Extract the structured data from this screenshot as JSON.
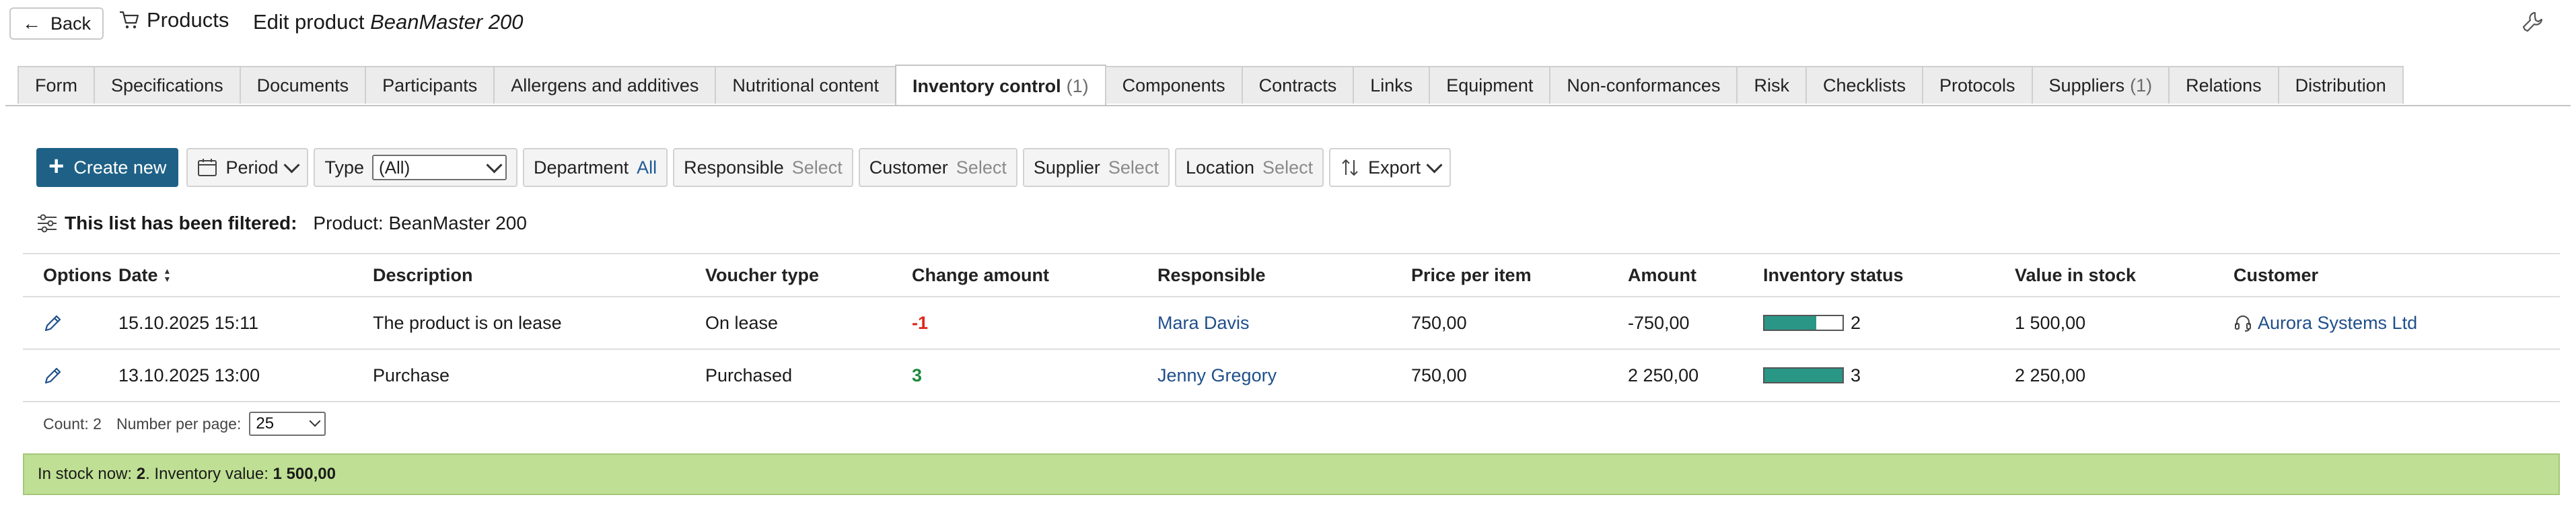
{
  "header": {
    "back_label": "Back",
    "breadcrumb_label": "Products",
    "title_prefix": "Edit product",
    "title_product": "BeanMaster 200"
  },
  "tabs": [
    {
      "label": "Form",
      "count": ""
    },
    {
      "label": "Specifications",
      "count": ""
    },
    {
      "label": "Documents",
      "count": ""
    },
    {
      "label": "Participants",
      "count": ""
    },
    {
      "label": "Allergens and additives",
      "count": ""
    },
    {
      "label": "Nutritional content",
      "count": ""
    },
    {
      "label": "Inventory control",
      "count": "(1)",
      "active": true
    },
    {
      "label": "Components",
      "count": ""
    },
    {
      "label": "Contracts",
      "count": ""
    },
    {
      "label": "Links",
      "count": ""
    },
    {
      "label": "Equipment",
      "count": ""
    },
    {
      "label": "Non-conformances",
      "count": ""
    },
    {
      "label": "Risk",
      "count": ""
    },
    {
      "label": "Checklists",
      "count": ""
    },
    {
      "label": "Protocols",
      "count": ""
    },
    {
      "label": "Suppliers",
      "count": "(1)"
    },
    {
      "label": "Relations",
      "count": ""
    },
    {
      "label": "Distribution",
      "count": ""
    }
  ],
  "toolbar": {
    "create_label": "Create new",
    "period_label": "Period",
    "type_label": "Type",
    "type_value": "(All)",
    "department_label": "Department",
    "department_value": "All",
    "responsible_label": "Responsible",
    "responsible_value": "Select",
    "customer_label": "Customer",
    "customer_value": "Select",
    "supplier_label": "Supplier",
    "supplier_value": "Select",
    "location_label": "Location",
    "location_value": "Select",
    "export_label": "Export"
  },
  "filter": {
    "label": "This list has been filtered:",
    "value": "Product: BeanMaster 200"
  },
  "table": {
    "columns": [
      "Options",
      "Date",
      "Description",
      "Voucher type",
      "Change amount",
      "Responsible",
      "Price per item",
      "Amount",
      "Inventory status",
      "Value in stock",
      "Customer"
    ],
    "rows": [
      {
        "date": "15.10.2025 15:11",
        "description": "The product is on lease",
        "voucher_type": "On lease",
        "change": "-1",
        "responsible": "Mara Davis",
        "price": "750,00",
        "amount": "-750,00",
        "inventory_status": "2",
        "inventory_fraction": 0.66,
        "value_in_stock": "1 500,00",
        "customer": "Aurora Systems Ltd"
      },
      {
        "date": "13.10.2025 13:00",
        "description": "Purchase",
        "voucher_type": "Purchased",
        "change": "3",
        "responsible": "Jenny Gregory",
        "price": "750,00",
        "amount": "2 250,00",
        "inventory_status": "3",
        "inventory_fraction": 1.0,
        "value_in_stock": "2 250,00",
        "customer": ""
      }
    ]
  },
  "footer": {
    "count_label": "Count: 2",
    "per_page_label": "Number per page:",
    "per_page_value": "25",
    "stock_prefix": "In stock now:",
    "stock_count": "2",
    "stock_mid": ". Inventory value:",
    "stock_value": "1 500,00"
  },
  "colors": {
    "primary": "#1f6186",
    "link": "#1f4f8b",
    "negative": "#e1261c",
    "positive": "#1e8a3c",
    "inventory_bar": "#2a9686",
    "stock_banner": "#bfe094"
  }
}
